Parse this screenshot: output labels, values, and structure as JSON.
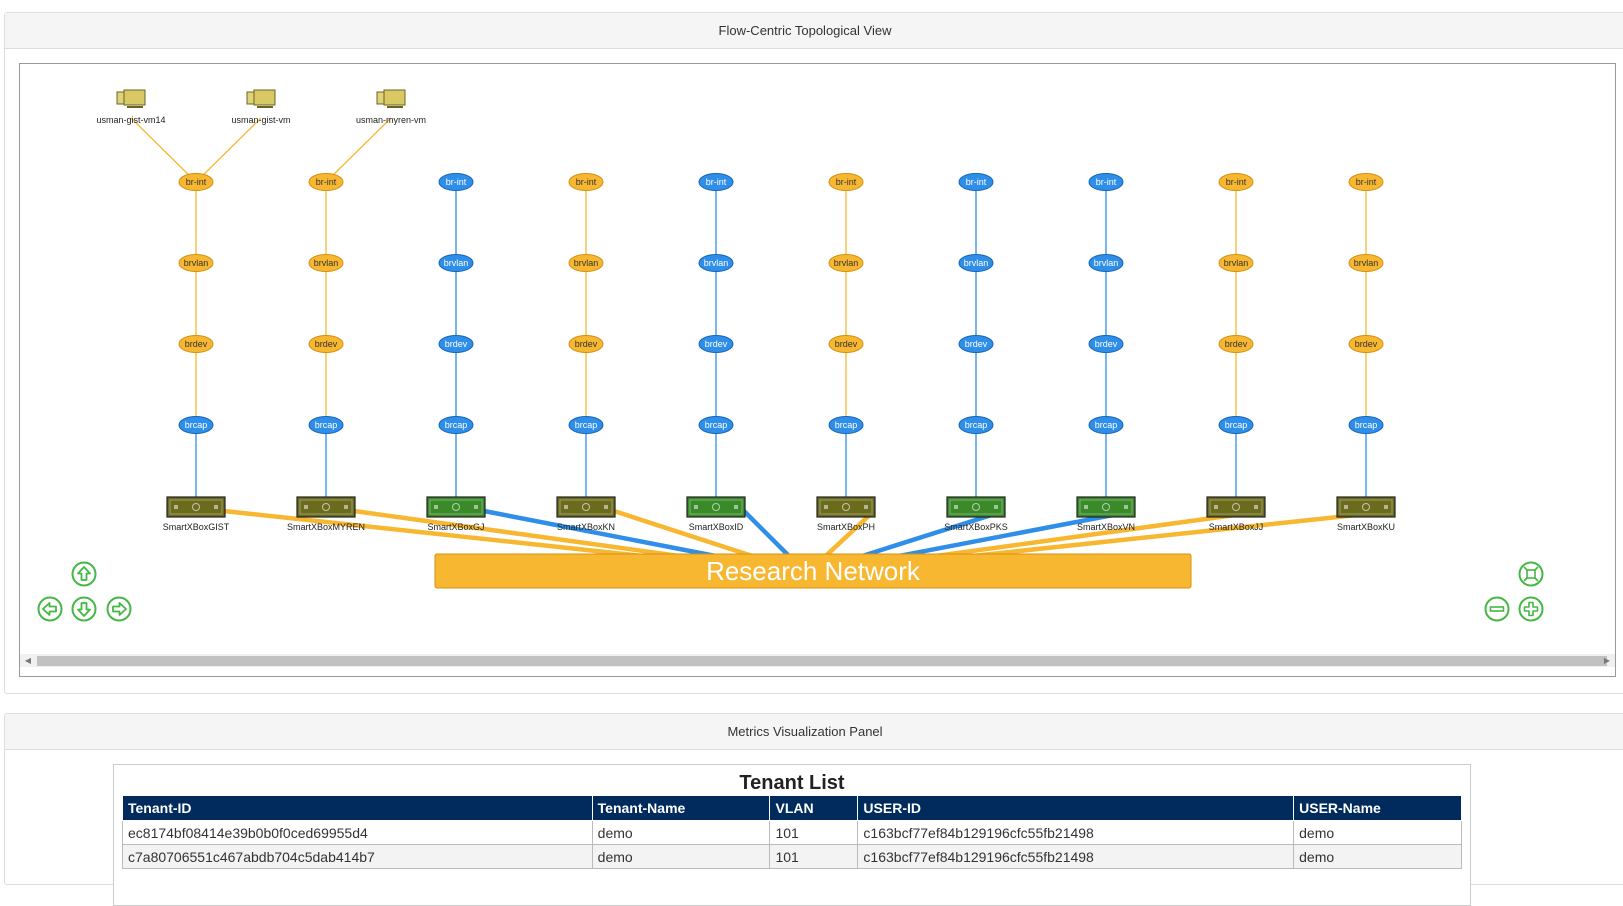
{
  "topology_panel": {
    "title": "Flow-Centric Topological View",
    "network_label": "Research Network",
    "vms": [
      {
        "label": "usman-gist-vm14"
      },
      {
        "label": "usman-gist-vm"
      },
      {
        "label": "usman-myren-vm"
      }
    ],
    "columns": [
      {
        "box": "SmartXBoxGIST",
        "color": "orange",
        "box_color": "olive",
        "nodes": [
          "br-int",
          "brvlan",
          "brdev",
          "brcap"
        ]
      },
      {
        "box": "SmartXBoxMYREN",
        "color": "orange",
        "box_color": "olive",
        "nodes": [
          "br-int",
          "brvlan",
          "brdev",
          "brcap"
        ]
      },
      {
        "box": "SmartXBoxGJ",
        "color": "blue",
        "box_color": "green",
        "nodes": [
          "br-int",
          "brvlan",
          "brdev",
          "brcap"
        ]
      },
      {
        "box": "SmartXBoxKN",
        "color": "orange",
        "box_color": "olive",
        "nodes": [
          "br-int",
          "brvlan",
          "brdev",
          "brcap"
        ]
      },
      {
        "box": "SmartXBoxID",
        "color": "blue",
        "box_color": "green",
        "nodes": [
          "br-int",
          "brvlan",
          "brdev",
          "brcap"
        ]
      },
      {
        "box": "SmartXBoxPH",
        "color": "orange",
        "box_color": "olive",
        "nodes": [
          "br-int",
          "brvlan",
          "brdev",
          "brcap"
        ]
      },
      {
        "box": "SmartXBoxPKS",
        "color": "blue",
        "box_color": "green",
        "nodes": [
          "br-int",
          "brvlan",
          "brdev",
          "brcap"
        ]
      },
      {
        "box": "SmartXBoxVN",
        "color": "blue",
        "box_color": "green",
        "nodes": [
          "br-int",
          "brvlan",
          "brdev",
          "brcap"
        ]
      },
      {
        "box": "SmartXBoxJJ",
        "color": "orange",
        "box_color": "olive",
        "nodes": [
          "br-int",
          "brvlan",
          "brdev",
          "brcap"
        ]
      },
      {
        "box": "SmartXBoxKU",
        "color": "orange",
        "box_color": "olive",
        "nodes": [
          "br-int",
          "brvlan",
          "brdev",
          "brcap"
        ]
      }
    ],
    "colors": {
      "orange": "#f7b731",
      "orange_stroke": "#d4900f",
      "blue": "#2f8fe8",
      "blue_stroke": "#1565b8",
      "olive": "#6b6b1e",
      "green": "#3a8a2a",
      "controls": "#45b745"
    },
    "controls": {
      "up": "pan-up-icon",
      "left": "pan-left-icon",
      "down": "pan-down-icon",
      "right": "pan-right-icon",
      "fit": "zoom-extent-icon",
      "zoom_out": "zoom-out-icon",
      "zoom_in": "zoom-in-icon"
    }
  },
  "metrics_panel": {
    "title": "Metrics Visualization Panel",
    "table_title": "Tenant List",
    "headers": [
      "Tenant-ID",
      "Tenant-Name",
      "VLAN",
      "USER-ID",
      "USER-Name"
    ],
    "rows": [
      [
        "ec8174bf08414e39b0b0f0ced69955d4",
        "demo",
        "101",
        "c163bcf77ef84b129196cfc55fb21498",
        "demo"
      ],
      [
        "c7a80706551c467abdb704c5dab414b7",
        "demo",
        "101",
        "c163bcf77ef84b129196cfc55fb21498",
        "demo"
      ]
    ]
  }
}
